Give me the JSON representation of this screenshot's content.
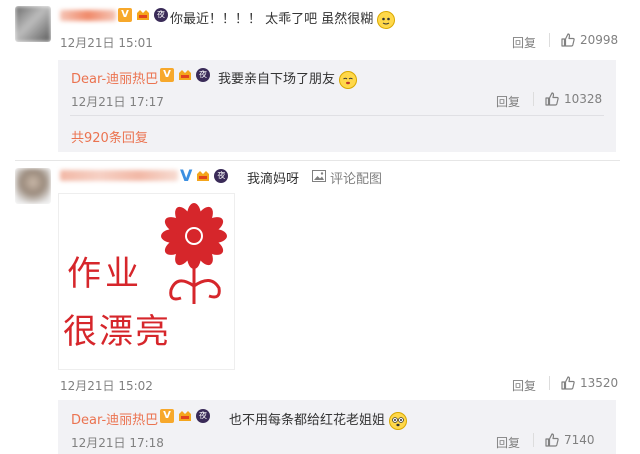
{
  "comments": [
    {
      "user_name": "",
      "text": "你最近！！！！ 太乖了吧 虽然很糊",
      "time": "12月21日 15:01",
      "reply_label": "回复",
      "likes": "20998",
      "replies": [
        {
          "user_name": "Dear-迪丽热巴",
          "text": "我要亲自下场了朋友",
          "time": "12月21日 17:17",
          "reply_label": "回复",
          "likes": "10328"
        }
      ],
      "more_replies": "共920条回复"
    },
    {
      "user_name": "",
      "text": "我滴妈呀",
      "pic_link": "评论配图",
      "image_text": [
        "作业",
        "很漂亮"
      ],
      "time": "12月21日 15:02",
      "reply_label": "回复",
      "likes": "13520",
      "replies": [
        {
          "user_name": "Dear-迪丽热巴",
          "text": "也不用每条都给红花老姐姐",
          "time": "12月21日 17:18",
          "reply_label": "回复",
          "likes": "7140"
        }
      ]
    }
  ],
  "badges": {
    "vip": "V",
    "night": "夜"
  },
  "colors": {
    "accent": "#eb7350",
    "reply_bg": "#f2f2f5",
    "flower_red": "#d6262b"
  },
  "icons": [
    "thumbs-up-icon",
    "image-icon",
    "vip-badge-icon",
    "night-badge-icon",
    "fan-badge-icon",
    "emoji-icon",
    "flower-icon"
  ]
}
